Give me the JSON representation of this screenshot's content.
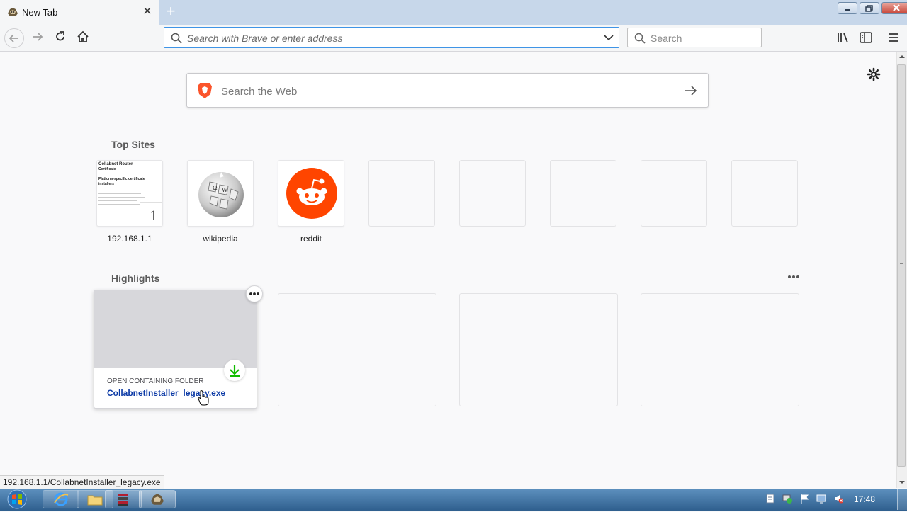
{
  "browser": {
    "tab_title": "New Tab",
    "url_placeholder": "Search with Brave or enter address",
    "search_placeholder": "Search",
    "status_text": "192.168.1.1/CollabnetInstaller_legacy.exe"
  },
  "newtab": {
    "web_search_placeholder": "Search the Web",
    "top_sites_title": "Top Sites",
    "top_sites": [
      {
        "label": "192.168.1.1",
        "badge": "1"
      },
      {
        "label": "wikipedia"
      },
      {
        "label": "reddit"
      }
    ],
    "highlights_title": "Highlights",
    "highlight_card": {
      "context": "OPEN CONTAINING FOLDER",
      "filename": "CollabnetInstaller_legacy.exe"
    },
    "preview_lines": [
      "Collabnet Router",
      "Certificate",
      "Platform-specific certificate installers"
    ]
  },
  "taskbar": {
    "time": "17:48"
  },
  "colors": {
    "accent": "#0a84ff",
    "reddit": "#ff4500",
    "brave": "#fb542b",
    "download_green": "#12bc00",
    "link": "#0c3aa6"
  }
}
